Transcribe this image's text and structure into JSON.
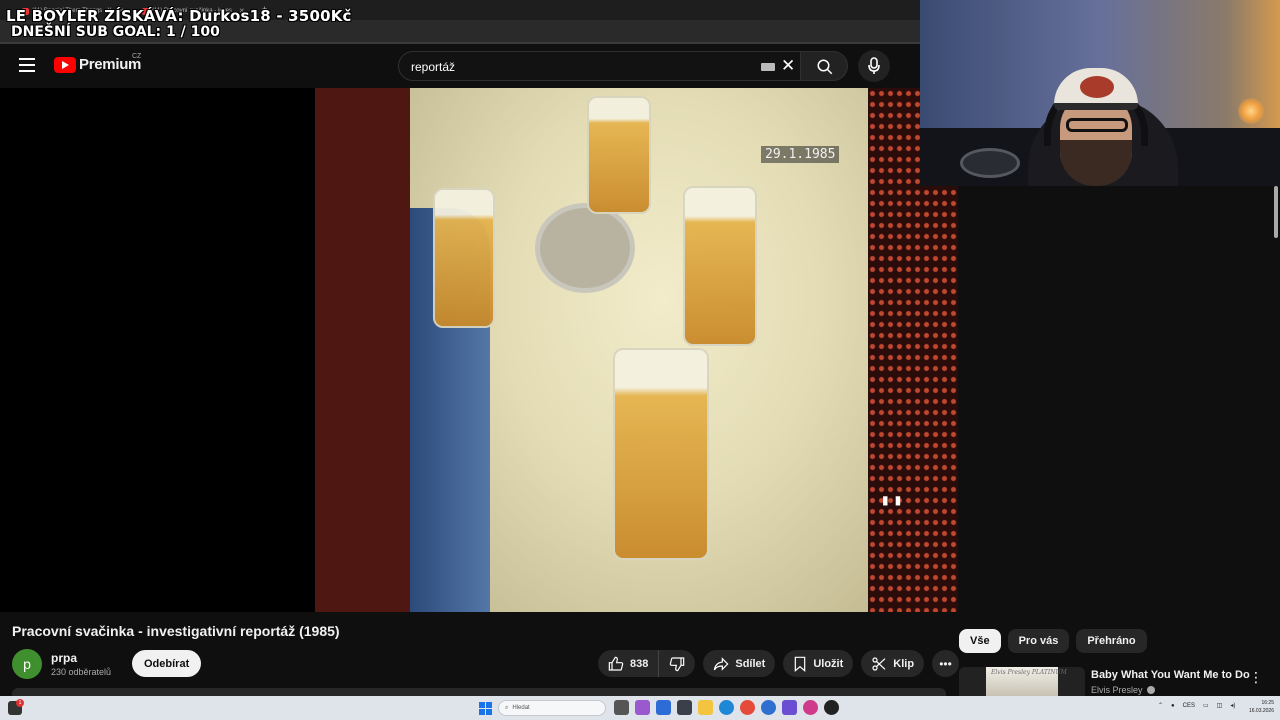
{
  "overlay": {
    "line1": "LE BOYLER ZÍSKÁVÁ: Durkos18 - 3500Kč",
    "line2": "DNEŠNÍ SUB GOAL: 1 / 100"
  },
  "browser": {
    "tabs": [
      {
        "label": "(11) Boogie' Them Thangs - Y"
      },
      {
        "label": "(11) Pracovní svačinka - inves"
      }
    ]
  },
  "header": {
    "logo_text": "Premium",
    "country_code": "CZ",
    "search_value": "reportáž"
  },
  "video": {
    "date_stamp": "29.1.1985",
    "title": "Pracovní svačinka - investigativní reportáž (1985)"
  },
  "channel": {
    "avatar_letter": "p",
    "name": "prpa",
    "subscribers": "230 odběratelů",
    "subscribe_label": "Odebírat"
  },
  "actions": {
    "likes": "838",
    "share_label": "Sdílet",
    "save_label": "Uložit",
    "clip_label": "Klip"
  },
  "chips": [
    {
      "label": "Vše",
      "active": true
    },
    {
      "label": "Pro vás",
      "active": false
    },
    {
      "label": "Přehráno",
      "active": false
    }
  ],
  "recommendation": {
    "title": "Baby What You Want Me to Do",
    "channel": "Elvis Presley",
    "thumb_text": "Elvis Presley PLATINUM"
  },
  "taskbar": {
    "search_placeholder": "Hledat",
    "notification_count": "1",
    "language": "CES",
    "time": "16:25",
    "date": "16.03.2026"
  },
  "colors": {
    "background": "#0f0f0f",
    "brand_red": "#ff0000",
    "chip_bg": "#272727",
    "taskbar": "#dfe3ea"
  }
}
